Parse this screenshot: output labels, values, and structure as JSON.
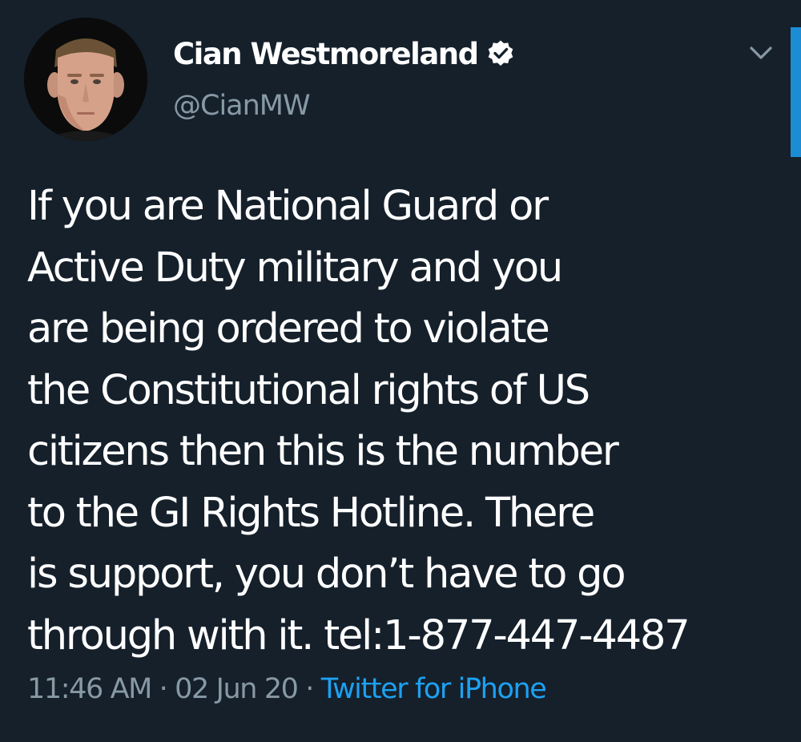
{
  "tweet": {
    "author": {
      "display_name": "Cian Westmoreland",
      "handle": "@CianMW",
      "verified": true
    },
    "text_lines": [
      "If you are National Guard or",
      "Active Duty military and you",
      "are being ordered to violate",
      "the Constitutional rights of US",
      "citizens then this is the number",
      "to the GI Rights Hotline. There",
      "is support, you don’t have to go",
      "through with it. tel:1-877-447-4487"
    ],
    "time": "11:46 AM",
    "date": "02 Jun 20",
    "separator": "·",
    "source": "Twitter for iPhone"
  },
  "icons": {
    "verified": "verified-badge-icon",
    "menu": "chevron-down-icon"
  },
  "colors": {
    "background": "#15202b",
    "text_primary": "#ffffff",
    "text_secondary": "#8899a6",
    "accent": "#1da1f2"
  }
}
